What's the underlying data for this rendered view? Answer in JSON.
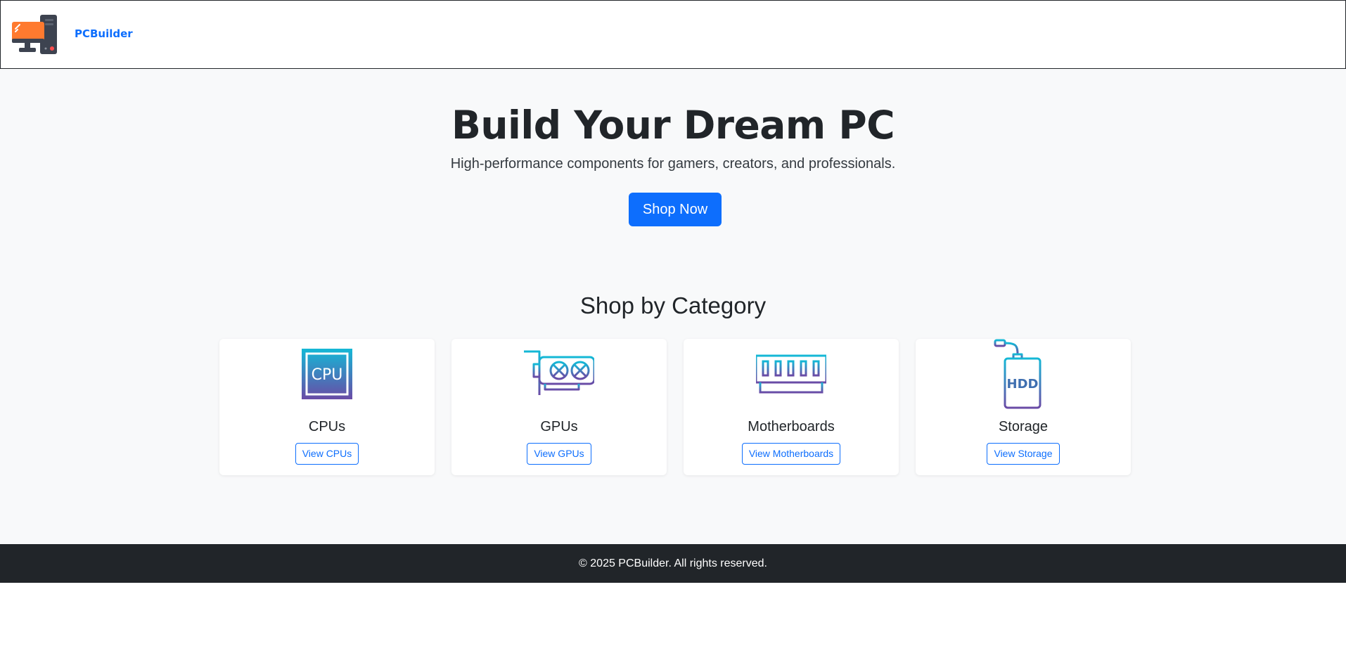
{
  "navbar": {
    "brand_name": "PCBuilder",
    "logo_icon": "desktop-computer-icon"
  },
  "hero": {
    "title": "Build Your Dream PC",
    "subtitle": "High-performance components for gamers, creators, and professionals.",
    "cta_label": "Shop Now"
  },
  "categories": {
    "section_title": "Shop by Category",
    "items": [
      {
        "name": "CPUs",
        "button_label": "View CPUs",
        "icon": "cpu-chip-icon",
        "icon_text": "CPU"
      },
      {
        "name": "GPUs",
        "button_label": "View GPUs",
        "icon": "graphics-card-icon"
      },
      {
        "name": "Motherboards",
        "button_label": "View Motherboards",
        "icon": "memory-module-icon"
      },
      {
        "name": "Storage",
        "button_label": "View Storage",
        "icon": "hard-drive-icon",
        "icon_text": "HDD"
      }
    ]
  },
  "footer": {
    "copyright": "© 2025 PCBuilder. All rights reserved."
  },
  "colors": {
    "primary": "#0d6efd",
    "dark": "#212529",
    "light_bg": "#f8f9fa",
    "logo_orange": "#ff7a2f",
    "icon_gradient_start": "#14b8d6",
    "icon_gradient_end": "#6a4ba6"
  }
}
